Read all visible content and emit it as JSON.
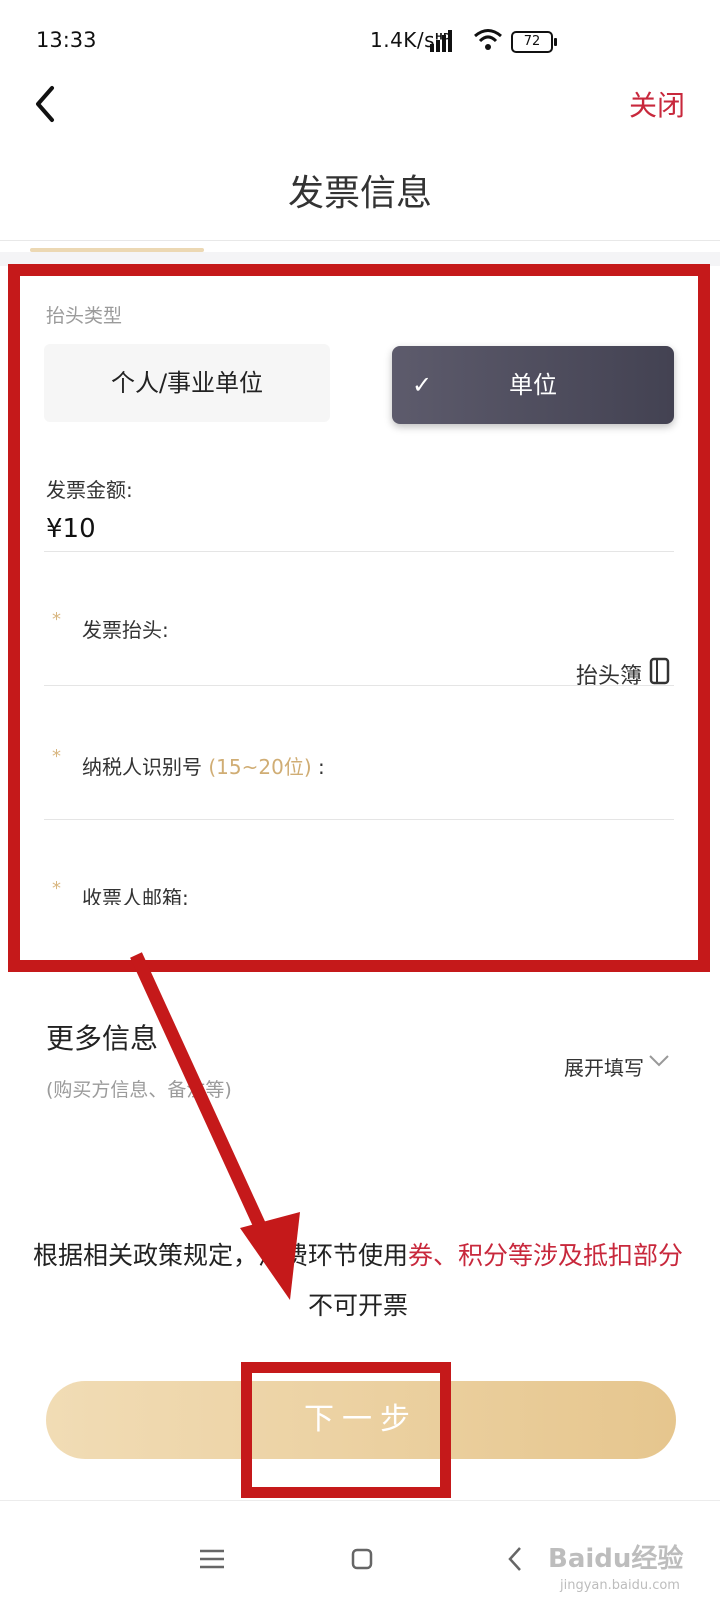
{
  "status_bar": {
    "time": "13:33",
    "network_speed": "1.4K/s",
    "network_tag": "HD",
    "battery": "72"
  },
  "header": {
    "close_label": "关闭",
    "title": "发票信息"
  },
  "form": {
    "title_type_label": "抬头类型",
    "options": {
      "personal": "个人/事业单位",
      "company": "单位",
      "selected": "单位"
    },
    "amount_label": "发票金额:",
    "amount_value": "¥10",
    "required_mark": "*",
    "invoice_title_label": "发票抬头:",
    "title_book_label": "抬头簿",
    "tax_id_label": "纳税人识别号",
    "tax_id_hint": "(15~20位)",
    "tax_id_colon": ":",
    "email_label": "收票人邮箱:"
  },
  "more_info": {
    "title": "更多信息",
    "subtitle": "(购买方信息、备注等)",
    "expand_label": "展开填写"
  },
  "notice": {
    "prefix": "根据相关政策规定，消费环节使用",
    "highlight": "券、积分等涉及抵扣部分",
    "suffix": "不可开票"
  },
  "next_button": {
    "label": "下一步"
  },
  "watermark": {
    "brand": "Baidu经验",
    "url": "jingyan.baidu.com"
  },
  "colors": {
    "accent_red": "#c8283c",
    "highlight_red": "#c5191a",
    "gold": "#e6c68e",
    "selected_dark": "#4d4c5d"
  }
}
